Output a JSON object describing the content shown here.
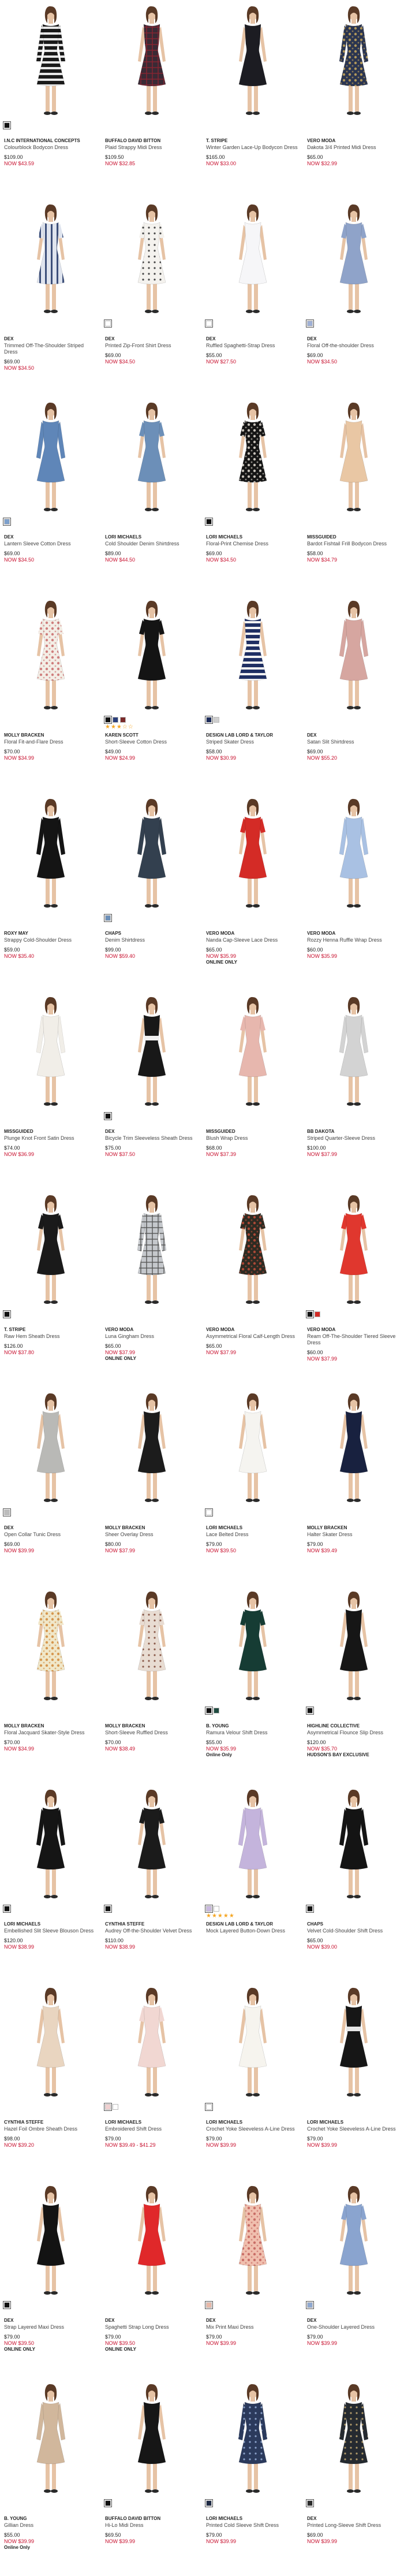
{
  "products": [
    {
      "brand": "I.N.C INTERNATIONAL CONCEPTS",
      "name": "Colourblock Bodycon Dress",
      "price": "$109.00",
      "sale": "NOW $43.59",
      "flag": "",
      "colors": [
        "#111111"
      ],
      "dress": "#1a1a1a",
      "accent": "#e8e8e8",
      "pattern": "stripes",
      "sleeve": "long",
      "stars": ""
    },
    {
      "brand": "BUFFALO DAVID BITTON",
      "name": "Plaid Strappy Midi Dress",
      "price": "$109.50",
      "sale": "NOW $32.85",
      "flag": "",
      "colors": [],
      "dress": "#3a2a35",
      "accent": "#8b2430",
      "pattern": "plaid",
      "sleeve": "none",
      "stars": ""
    },
    {
      "brand": "T. STRIPE",
      "name": "Winter Garden Lace-Up Bodycon Dress",
      "price": "$165.00",
      "sale": "NOW $33.00",
      "flag": "",
      "colors": [],
      "dress": "#1c1c22",
      "accent": "#333",
      "pattern": "solid",
      "sleeve": "none",
      "stars": ""
    },
    {
      "brand": "VERO MODA",
      "name": "Dakota 3/4 Printed Midi Dress",
      "price": "$65.00",
      "sale": "NOW $32.99",
      "flag": "",
      "colors": [],
      "dress": "#2b3550",
      "accent": "#c9a85a",
      "pattern": "floral",
      "sleeve": "long",
      "stars": ""
    },
    {
      "brand": "DEX",
      "name": "Trimmed Off-The-Shoulder Striped Dress",
      "price": "$69.00",
      "sale": "NOW $34.50",
      "flag": "",
      "colors": [],
      "dress": "#dfe4ee",
      "accent": "#3d4f7a",
      "pattern": "vstripes",
      "sleeve": "short",
      "stars": ""
    },
    {
      "brand": "DEX",
      "name": "Printed Zip-Front Shirt Dress",
      "price": "$69.00",
      "sale": "NOW $34.50",
      "flag": "",
      "colors": [
        "#ffffff"
      ],
      "dress": "#f4f2ee",
      "accent": "#444",
      "pattern": "dots",
      "sleeve": "short",
      "stars": ""
    },
    {
      "brand": "DEX",
      "name": "Ruffled Spaghetti-Strap Dress",
      "price": "$55.00",
      "sale": "NOW $27.50",
      "flag": "",
      "colors": [
        "#ffffff"
      ],
      "dress": "#f6f6f8",
      "accent": "#ddd",
      "pattern": "solid",
      "sleeve": "none",
      "stars": ""
    },
    {
      "brand": "DEX",
      "name": "Floral Off-the-shoulder Dress",
      "price": "$69.00",
      "sale": "NOW $34.50",
      "flag": "",
      "colors": [
        "#9fb0d6"
      ],
      "dress": "#8fa3c9",
      "accent": "#6b7fa8",
      "pattern": "solid",
      "sleeve": "short",
      "stars": ""
    },
    {
      "brand": "DEX",
      "name": "Lantern Sleeve Cotton Dress",
      "price": "$69.00",
      "sale": "NOW $34.50",
      "flag": "",
      "colors": [
        "#7da0cc"
      ],
      "dress": "#5f86b8",
      "accent": "#3c5d8a",
      "pattern": "solid",
      "sleeve": "long",
      "stars": ""
    },
    {
      "brand": "LORI MICHAELS",
      "name": "Cold Shoulder Denim Shirtdress",
      "price": "$89.00",
      "sale": "NOW $44.50",
      "flag": "",
      "colors": [],
      "dress": "#6c8fb8",
      "accent": "#4c6c92",
      "pattern": "solid",
      "sleeve": "short",
      "stars": ""
    },
    {
      "brand": "LORI MICHAELS",
      "name": "Floral-Print Chemise Dress",
      "price": "$69.00",
      "sale": "NOW $34.50",
      "flag": "",
      "colors": [
        "#111111"
      ],
      "dress": "#151515",
      "accent": "#e5e0d6",
      "pattern": "floral",
      "sleeve": "short",
      "stars": ""
    },
    {
      "brand": "MISSGUIDED",
      "name": "Bardot Fishtail Frill Bodycon Dress",
      "price": "$58.00",
      "sale": "NOW $34.79",
      "flag": "",
      "colors": [],
      "dress": "#e9c7a4",
      "accent": "#d4a57c",
      "pattern": "solid",
      "sleeve": "none",
      "stars": ""
    },
    {
      "brand": "MOLLY BRACKEN",
      "name": "Floral Fit-and-Flare Dress",
      "price": "$70.00",
      "sale": "NOW $34.99",
      "flag": "",
      "colors": [],
      "dress": "#f3eee6",
      "accent": "#c96b6b",
      "pattern": "floral",
      "sleeve": "short",
      "stars": ""
    },
    {
      "brand": "KAREN SCOTT",
      "name": "Short-Sleeve Cotton Dress",
      "price": "$49.00",
      "sale": "NOW $24.99",
      "flag": "",
      "colors": [
        "#111111",
        "#2a3e7a",
        "#7a2a2a"
      ],
      "dress": "#141414",
      "accent": "#333",
      "pattern": "solid",
      "sleeve": "short",
      "stars": "★★★☆☆"
    },
    {
      "brand": "DESIGN LAB LORD & TAYLOR",
      "name": "Striped Skater Dress",
      "price": "$58.00",
      "sale": "NOW $30.99",
      "flag": "",
      "colors": [
        "#1c2b5a",
        "#cfcfcf"
      ],
      "dress": "#1f2f63",
      "accent": "#f2f2f2",
      "pattern": "stripes",
      "sleeve": "none",
      "stars": ""
    },
    {
      "brand": "DEX",
      "name": "Satan Slit Shirtdress",
      "price": "$69.00",
      "sale": "NOW $55.20",
      "flag": "",
      "colors": [],
      "dress": "#d6a6a0",
      "accent": "#b98580",
      "pattern": "solid",
      "sleeve": "long",
      "stars": ""
    },
    {
      "brand": "ROXY MAY",
      "name": "Strappy Cold-Shoulder Dress",
      "price": "$59.00",
      "sale": "NOW $35.40",
      "flag": "",
      "colors": [],
      "dress": "#141414",
      "accent": "#333",
      "pattern": "solid",
      "sleeve": "long",
      "stars": ""
    },
    {
      "brand": "CHAPS",
      "name": "Denim Shirtdress",
      "price": "$99.00",
      "sale": "NOW $59.40",
      "flag": "",
      "colors": [
        "#6c8fb8"
      ],
      "dress": "#33404f",
      "accent": "#55657a",
      "pattern": "solid",
      "sleeve": "long",
      "stars": ""
    },
    {
      "brand": "VERO MODA",
      "name": "Nanda Cap-Sleeve Lace Dress",
      "price": "$65.00",
      "sale": "NOW $35.99",
      "flag": "ONLINE ONLY",
      "colors": [],
      "dress": "#d42b26",
      "accent": "#a51d1a",
      "pattern": "solid",
      "sleeve": "short",
      "stars": ""
    },
    {
      "brand": "VERO MODA",
      "name": "Rozzy Henna Ruffle Wrap Dress",
      "price": "$60.00",
      "sale": "NOW $35.99",
      "flag": "",
      "colors": [],
      "dress": "#a9c1e3",
      "accent": "#8aa6cc",
      "pattern": "solid",
      "sleeve": "long",
      "stars": ""
    },
    {
      "brand": "MISSGUIDED",
      "name": "Plunge Knot Front Satin Dress",
      "price": "$74.00",
      "sale": "NOW $36.99",
      "flag": "",
      "colors": [],
      "dress": "#f1eee8",
      "accent": "#ddd",
      "pattern": "solid",
      "sleeve": "long",
      "stars": ""
    },
    {
      "brand": "DEX",
      "name": "Bicycle Trim Sleeveless Sheath Dress",
      "price": "$75.00",
      "sale": "NOW $37.50",
      "flag": "",
      "colors": [
        "#111111"
      ],
      "dress": "#181818",
      "accent": "#f0f0f0",
      "pattern": "band",
      "sleeve": "none",
      "stars": ""
    },
    {
      "brand": "MISSGUIDED",
      "name": "Blush Wrap Dress",
      "price": "$68.00",
      "sale": "NOW $37.39",
      "flag": "",
      "colors": [],
      "dress": "#e7b7ae",
      "accent": "#cf9a90",
      "pattern": "solid",
      "sleeve": "short",
      "stars": ""
    },
    {
      "brand": "BB DAKOTA",
      "name": "Striped Quarter-Sleeve Dress",
      "price": "$100.00",
      "sale": "NOW $37.99",
      "flag": "",
      "colors": [],
      "dress": "#d3d3d3",
      "accent": "#bbb",
      "pattern": "solid",
      "sleeve": "long",
      "stars": ""
    },
    {
      "brand": "T. STRIPE",
      "name": "Raw Hem Sheath Dress",
      "price": "$126.00",
      "sale": "NOW $37.80",
      "flag": "",
      "colors": [
        "#111111"
      ],
      "dress": "#1a1a1a",
      "accent": "#333",
      "pattern": "solid",
      "sleeve": "short",
      "stars": ""
    },
    {
      "brand": "VERO MODA",
      "name": "Luna Gingham Dress",
      "price": "$65.00",
      "sale": "NOW $37.99",
      "flag": "ONLINE ONLY",
      "colors": [],
      "dress": "#c5c8cc",
      "accent": "#555",
      "pattern": "plaid",
      "sleeve": "long",
      "stars": ""
    },
    {
      "brand": "VERO MODA",
      "name": "Asymmetrical Floral Calf-Length Dress",
      "price": "$65.00",
      "sale": "NOW $37.99",
      "flag": "",
      "colors": [],
      "dress": "#2e2b22",
      "accent": "#c24e3a",
      "pattern": "floral",
      "sleeve": "short",
      "stars": ""
    },
    {
      "brand": "VERO MODA",
      "name": "Ream Off-The-Shoulder Tiered Sleeve Dress",
      "price": "$60.00",
      "sale": "NOW $37.99",
      "flag": "",
      "colors": [
        "#111111",
        "#d42b26"
      ],
      "dress": "#e0372e",
      "accent": "#b5251e",
      "pattern": "solid",
      "sleeve": "short",
      "stars": ""
    },
    {
      "brand": "DEX",
      "name": "Open Collar Tunic Dress",
      "price": "$69.00",
      "sale": "NOW $39.99",
      "flag": "",
      "colors": [
        "#bcbcbc"
      ],
      "dress": "#b9b9b6",
      "accent": "#999",
      "pattern": "solid",
      "sleeve": "none",
      "stars": ""
    },
    {
      "brand": "MOLLY BRACKEN",
      "name": "Sheer Overlay Dress",
      "price": "$80.00",
      "sale": "NOW $37.99",
      "flag": "",
      "colors": [],
      "dress": "#1c1c1c",
      "accent": "#3a3a3a",
      "pattern": "solid",
      "sleeve": "none",
      "stars": ""
    },
    {
      "brand": "LORI MICHAELS",
      "name": "Lace Belted Dress",
      "price": "$79.00",
      "sale": "NOW $39.50",
      "flag": "",
      "colors": [
        "#ffffff"
      ],
      "dress": "#f5f4f0",
      "accent": "#cfcfcf",
      "pattern": "solid",
      "sleeve": "none",
      "stars": ""
    },
    {
      "brand": "MOLLY BRACKEN",
      "name": "Halter Skater Dress",
      "price": "$79.00",
      "sale": "NOW $39.49",
      "flag": "",
      "colors": [],
      "dress": "#18213f",
      "accent": "#2c3866",
      "pattern": "solid",
      "sleeve": "none",
      "stars": ""
    },
    {
      "brand": "MOLLY BRACKEN",
      "name": "Floral Jacquard Skater-Style Dress",
      "price": "$70.00",
      "sale": "NOW $34.99",
      "flag": "",
      "colors": [],
      "dress": "#f0e7c9",
      "accent": "#d18a3a",
      "pattern": "floral",
      "sleeve": "short",
      "stars": ""
    },
    {
      "brand": "MOLLY BRACKEN",
      "name": "Short-Sleeve Ruffled Dress",
      "price": "$70.00",
      "sale": "NOW $38.49",
      "flag": "",
      "colors": [],
      "dress": "#e8dcd2",
      "accent": "#8a5a4a",
      "pattern": "dots",
      "sleeve": "short",
      "stars": ""
    },
    {
      "brand": "B. YOUNG",
      "name": "Ramura Velour Shift Dress",
      "price": "$55.00",
      "sale": "NOW $35.99",
      "flag": "Online Only",
      "colors": [
        "#111111",
        "#1f4b40"
      ],
      "dress": "#163c34",
      "accent": "#0f2a24",
      "pattern": "solid",
      "sleeve": "short",
      "stars": ""
    },
    {
      "brand": "HIGHLINE COLLECTIVE",
      "name": "Asymmetrical Flounce Slip Dress",
      "price": "$120.00",
      "sale": "NOW $35.70",
      "flag": "HUDSON'S BAY EXCLUSIVE",
      "colors": [
        "#111111"
      ],
      "dress": "#161616",
      "accent": "#2a2a2a",
      "pattern": "solid",
      "sleeve": "none",
      "stars": ""
    },
    {
      "brand": "LORI MICHAELS",
      "name": "Embellished Slit Sleeve Blouson Dress",
      "price": "$120.00",
      "sale": "NOW $38.99",
      "flag": "",
      "colors": [
        "#111111"
      ],
      "dress": "#151515",
      "accent": "#2a2a2a",
      "pattern": "solid",
      "sleeve": "long",
      "stars": ""
    },
    {
      "brand": "CYNTHIA STEFFE",
      "name": "Audrey Off-the-Shoulder Velvet Dress",
      "price": "$110.00",
      "sale": "NOW $38.99",
      "flag": "",
      "colors": [
        "#111111"
      ],
      "dress": "#1b1b1b",
      "accent": "#333",
      "pattern": "solid",
      "sleeve": "short",
      "stars": ""
    },
    {
      "brand": "DESIGN LAB LORD & TAYLOR",
      "name": "Mock Layered Button-Down Dress",
      "price": "",
      "sale": "",
      "flag": "",
      "colors": [
        "#c9b8e0",
        "#ffffff"
      ],
      "dress": "#c4b4dc",
      "accent": "#f4f4f4",
      "pattern": "solid",
      "sleeve": "long",
      "stars": "★★★★★"
    },
    {
      "brand": "CHAPS",
      "name": "Velvet Cold-Shoulder Shift Dress",
      "price": "$65.00",
      "sale": "NOW $39.00",
      "flag": "",
      "colors": [
        "#111111"
      ],
      "dress": "#141414",
      "accent": "#2a2a2a",
      "pattern": "solid",
      "sleeve": "long",
      "stars": ""
    },
    {
      "brand": "CYNTHIA STEFFE",
      "name": "Hazel Foil Ombre Sheath Dress",
      "price": "$98.00",
      "sale": "NOW $39.20",
      "flag": "",
      "colors": [],
      "dress": "#e9d5c0",
      "accent": "#d2b79c",
      "pattern": "solid",
      "sleeve": "none",
      "stars": ""
    },
    {
      "brand": "LORI MICHAELS",
      "name": "Embroidered Shift Dress",
      "price": "$79.00",
      "sale": "NOW $39.49 - $41.29",
      "flag": "",
      "colors": [
        "#f0d0d0",
        "#ffffff"
      ],
      "dress": "#f1d7d2",
      "accent": "#ddb3ab",
      "pattern": "solid",
      "sleeve": "short",
      "stars": ""
    },
    {
      "brand": "LORI MICHAELS",
      "name": "Crochet Yoke Sleeveless A-Line Dress",
      "price": "$79.00",
      "sale": "NOW $39.99",
      "flag": "",
      "colors": [
        "#ffffff"
      ],
      "dress": "#f6f4ee",
      "accent": "#ddd",
      "pattern": "solid",
      "sleeve": "none",
      "stars": ""
    },
    {
      "brand": "LORI MICHAELS",
      "name": "Crochet Yoke Sleeveless A-Line Dress",
      "price": "$79.00",
      "sale": "NOW $39.99",
      "flag": "",
      "colors": [],
      "dress": "#161616",
      "accent": "#e6e6e6",
      "pattern": "band",
      "sleeve": "none",
      "stars": ""
    },
    {
      "brand": "DEX",
      "name": "Strap Layered Maxi Dress",
      "price": "$79.00",
      "sale": "NOW $39.50",
      "flag": "ONLINE ONLY",
      "colors": [
        "#111111"
      ],
      "dress": "#131313",
      "accent": "#2a2a2a",
      "pattern": "solid",
      "sleeve": "none",
      "stars": ""
    },
    {
      "brand": "DEX",
      "name": "Spaghetti Strap Long Dress",
      "price": "$79.00",
      "sale": "NOW $39.50",
      "flag": "ONLINE ONLY",
      "colors": [],
      "dress": "#e0282a",
      "accent": "#b51d1f",
      "pattern": "solid",
      "sleeve": "none",
      "stars": ""
    },
    {
      "brand": "DEX",
      "name": "Mix Print Maxi Dress",
      "price": "$79.00",
      "sale": "NOW $39.99",
      "flag": "",
      "colors": [
        "#e8b8a8"
      ],
      "dress": "#f0bfae",
      "accent": "#c2605a",
      "pattern": "floral",
      "sleeve": "none",
      "stars": ""
    },
    {
      "brand": "DEX",
      "name": "One-Shoulder Layered Dress",
      "price": "$79.00",
      "sale": "NOW $39.99",
      "flag": "",
      "colors": [
        "#8fa8d0"
      ],
      "dress": "#8aa4cf",
      "accent": "#6b86b3",
      "pattern": "solid",
      "sleeve": "short",
      "stars": ""
    },
    {
      "brand": "B. YOUNG",
      "name": "Gillian Dress",
      "price": "$55.00",
      "sale": "NOW $39.99",
      "flag": "Online Only",
      "colors": [],
      "dress": "#d1b79c",
      "accent": "#b59a7e",
      "pattern": "solid",
      "sleeve": "long",
      "stars": ""
    },
    {
      "brand": "BUFFALO DAVID BITTON",
      "name": "Hi-Lo Midi Dress",
      "price": "$69.50",
      "sale": "NOW $39.99",
      "flag": "",
      "colors": [
        "#111111"
      ],
      "dress": "#161616",
      "accent": "#2a2a2a",
      "pattern": "solid",
      "sleeve": "none",
      "stars": ""
    },
    {
      "brand": "LORI MICHAELS",
      "name": "Printed Cold Sleeve Shift Dress",
      "price": "$79.00",
      "sale": "NOW $39.99",
      "flag": "",
      "colors": [
        "#1e2a44"
      ],
      "dress": "#2b3a5c",
      "accent": "#8aa0c8",
      "pattern": "dots",
      "sleeve": "long",
      "stars": ""
    },
    {
      "brand": "DEX",
      "name": "Printed Long-Sleeve Shift Dress",
      "price": "$69.00",
      "sale": "NOW $39.99",
      "flag": "",
      "colors": [
        "#2a2a2a"
      ],
      "dress": "#252a30",
      "accent": "#b09a6a",
      "pattern": "dots",
      "sleeve": "long",
      "stars": ""
    }
  ]
}
